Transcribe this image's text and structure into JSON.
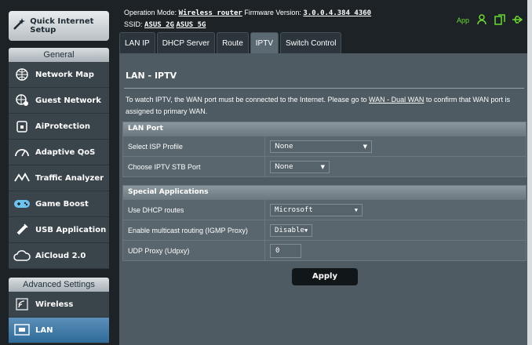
{
  "sidebar": {
    "quick_setup_label": "Quick Internet Setup",
    "general_header": "General",
    "general_items": [
      {
        "label": "Network Map",
        "icon": "network-map-icon"
      },
      {
        "label": "Guest Network",
        "icon": "guest-network-icon"
      },
      {
        "label": "AiProtection",
        "icon": "lock-icon"
      },
      {
        "label": "Adaptive QoS",
        "icon": "gauge-icon"
      },
      {
        "label": "Traffic Analyzer",
        "icon": "traffic-icon"
      },
      {
        "label": "Game Boost",
        "icon": "gamepad-icon"
      },
      {
        "label": "USB Application",
        "icon": "usb-icon"
      },
      {
        "label": "AiCloud 2.0",
        "icon": "cloud-icon"
      }
    ],
    "advanced_header": "Advanced Settings",
    "advanced_items": [
      {
        "label": "Wireless",
        "icon": "wireless-icon"
      },
      {
        "label": "LAN",
        "icon": "lan-icon",
        "active": true
      }
    ]
  },
  "topbar": {
    "operation_mode_label": "Operation Mode:",
    "operation_mode_value": "Wireless router",
    "firmware_label": "Firmware Version:",
    "firmware_value": "3.0.0.4.384_4360",
    "ssid_label": "SSID:",
    "ssid_values": [
      "ASUS_2G",
      "ASUS_5G"
    ],
    "app_label": "App",
    "status_icons": [
      "user-icon",
      "copy-icon",
      "usb-status-icon"
    ]
  },
  "tabs": [
    "LAN IP",
    "DHCP Server",
    "Route",
    "IPTV",
    "Switch Control"
  ],
  "active_tab": "IPTV",
  "page": {
    "title": "LAN - IPTV",
    "description_before": "To watch IPTV, the WAN port must be connected to the Internet. Please go to ",
    "description_link": "WAN - Dual WAN",
    "description_after": " to confirm that WAN port is assigned to primary WAN."
  },
  "lan_port": {
    "header": "LAN Port",
    "isp_profile_label": "Select ISP Profile",
    "isp_profile_value": "None",
    "stb_port_label": "Choose IPTV STB Port",
    "stb_port_value": "None"
  },
  "special_apps": {
    "header": "Special Applications",
    "dhcp_routes_label": "Use DHCP routes",
    "dhcp_routes_value": "Microsoft",
    "multicast_label": "Enable multicast routing (IGMP Proxy)",
    "multicast_value": "Disable",
    "udpxy_label": "UDP Proxy (Udpxy)",
    "udpxy_value": "0"
  },
  "apply_label": "Apply",
  "colors": {
    "accent_active": "#2f6b99",
    "status_green": "#6bdc2e"
  }
}
